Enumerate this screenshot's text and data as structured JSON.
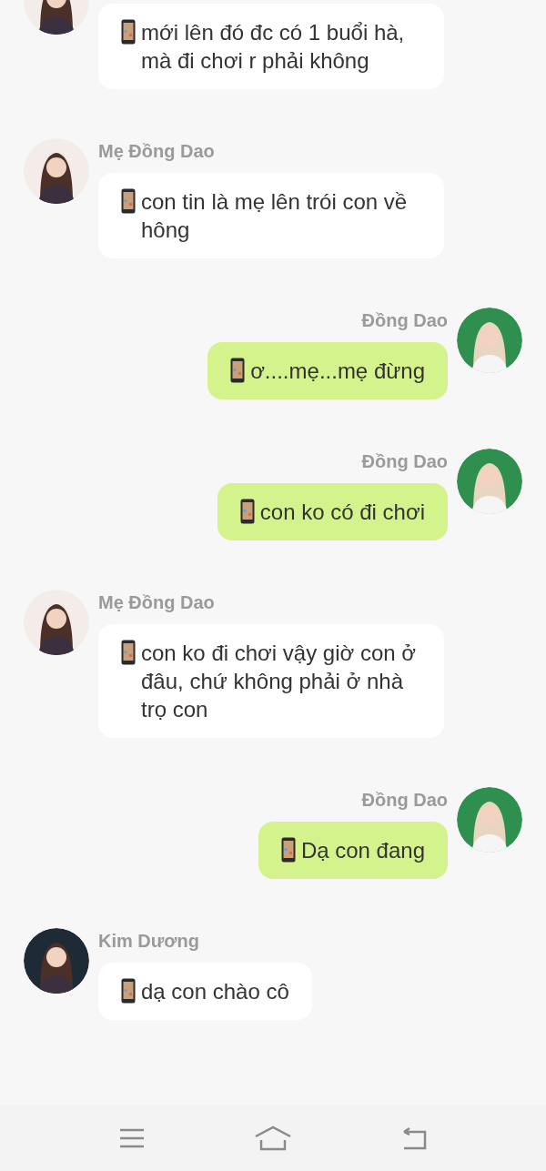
{
  "messages": [
    {
      "kind": "received",
      "color": "#f3ece8",
      "text": "mới lên đó đc có 1 buổi hà, mà đi chơi r phải không"
    },
    {
      "kind": "received",
      "color": "#f3ece8",
      "name": "Mẹ Đồng Dao",
      "text": "con tin là mẹ lên trói con về hông"
    },
    {
      "kind": "sent",
      "color": "#2f8f4e",
      "name": "Đồng Dao",
      "text": "ơ....mẹ...mẹ đừng"
    },
    {
      "kind": "sent",
      "color": "#2f8f4e",
      "name": "Đồng Dao",
      "text": "con ko có đi chơi"
    },
    {
      "kind": "received",
      "color": "#f3ece8",
      "name": "Mẹ Đồng Dao",
      "text": "con ko đi chơi vậy giờ con ở đâu, chứ không phải ở nhà trọ con"
    },
    {
      "kind": "sent",
      "color": "#2f8f4e",
      "name": "Đồng Dao",
      "text": "Dạ con đang"
    },
    {
      "kind": "received",
      "color": "#1e2a35",
      "name": "Kim Dương",
      "text": "dạ con chào cô"
    }
  ]
}
